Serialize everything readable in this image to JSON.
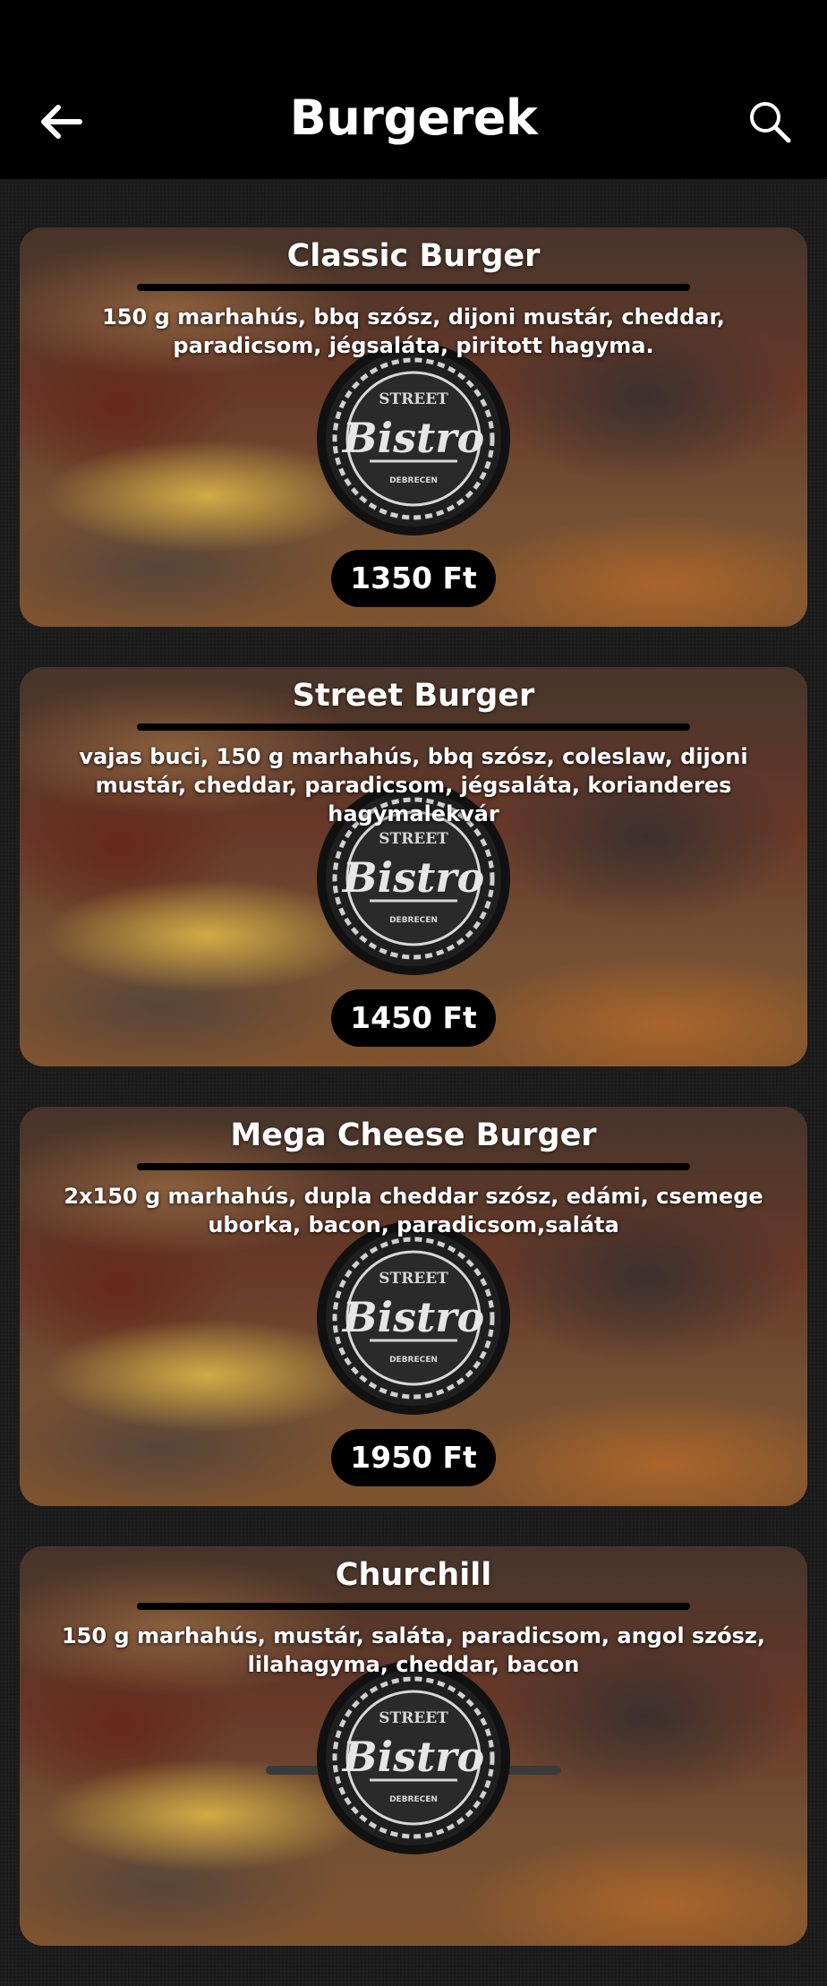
{
  "header": {
    "title": "Burgerek"
  },
  "logo": {
    "top": "STREET",
    "script": "Bistro",
    "bottom": "DEBRECEN"
  },
  "items": [
    {
      "name": "Classic Burger",
      "description": "150 g marhahús, bbq szósz, dijoni mustár, cheddar, paradicsom, jégsaláta, piritott hagyma.",
      "price": "1350 Ft"
    },
    {
      "name": "Street Burger",
      "description": "vajas buci, 150 g marhahús, bbq szósz, coleslaw, dijoni mustár, cheddar, paradicsom, jégsaláta, korianderes hagymalekvár",
      "price": "1450 Ft"
    },
    {
      "name": "Mega Cheese Burger",
      "description": "2x150 g marhahús, dupla cheddar szósz, edámi, csemege uborka, bacon, paradicsom,saláta",
      "price": "1950 Ft"
    },
    {
      "name": "Churchill",
      "description": "150 g marhahús, mustár, saláta, paradicsom, angol szósz, lilahagyma, cheddar, bacon"
    }
  ]
}
